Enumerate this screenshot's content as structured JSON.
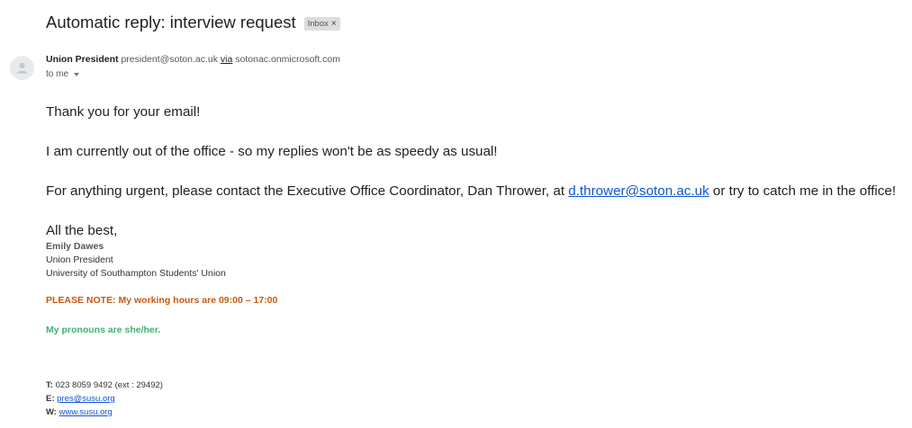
{
  "header": {
    "subject": "Automatic reply: interview request",
    "label": "Inbox",
    "label_remove": "×"
  },
  "sender": {
    "name": "Union President",
    "email": "president@soton.ac.uk",
    "via_label": "via",
    "via_domain": "sotonac.onmicrosoft.com",
    "recipient": "to me"
  },
  "message": {
    "line1": "Thank you for your email!",
    "line2": "I am currently out of the office - so my replies won't be as speedy as usual!",
    "line3_prefix": "For anything urgent, please contact the Executive Office Coordinator, Dan Thrower, at ",
    "line3_link": "d.thrower@soton.ac.uk",
    "line3_suffix": " or try to catch me in the office!",
    "closing": "All the best,"
  },
  "signature": {
    "name": "Emily Dawes",
    "title": "Union President",
    "org": "University of Southampton Students' Union",
    "note_hours": "PLEASE NOTE: My working hours are 09:00 – 17:00",
    "note_pronouns": "My pronouns are she/her.",
    "phone_label": "T:",
    "phone": "023 8059 9492 (ext : 29492)",
    "email_label": "E:",
    "email": "pres@susu.org",
    "web_label": "W:",
    "web": "www.susu.org"
  },
  "colors": {
    "link": "#1155cc",
    "note_orange": "#c55a11",
    "note_green": "#3cb371"
  }
}
